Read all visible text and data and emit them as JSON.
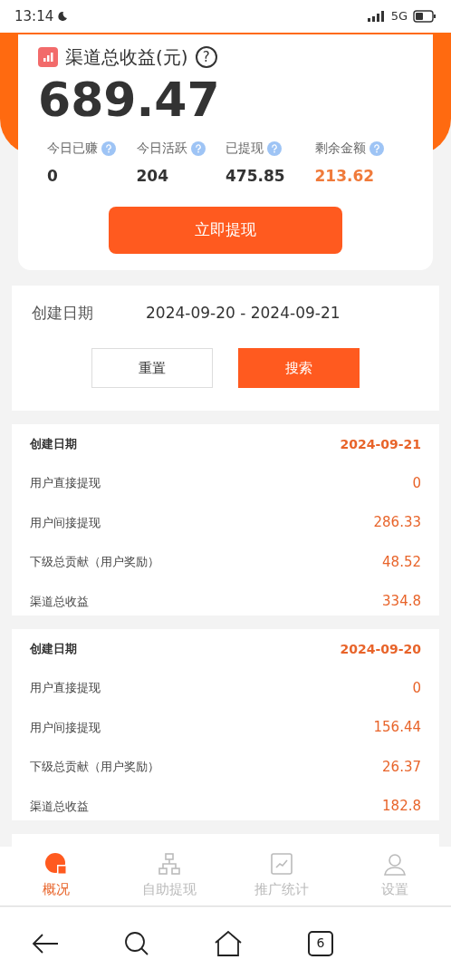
{
  "status_bar": {
    "time": "13:14",
    "network": "5G"
  },
  "summary": {
    "title": "渠道总收益(元)",
    "help": "?",
    "total": "689.47",
    "stats": [
      {
        "label": "今日已赚",
        "value": "0",
        "highlight": false
      },
      {
        "label": "今日活跃",
        "value": "204",
        "highlight": false
      },
      {
        "label": "已提现",
        "value": "475.85",
        "highlight": false
      },
      {
        "label": "剩余金额",
        "value": "213.62",
        "highlight": true
      }
    ],
    "withdraw_button": "立即提现"
  },
  "filter": {
    "label": "创建日期",
    "date_range": "2024-09-20 - 2024-09-21",
    "reset_button": "重置",
    "search_button": "搜索"
  },
  "records": [
    {
      "date_label": "创建日期",
      "date": "2024-09-21",
      "fields": [
        {
          "label": "用户直接提现",
          "value": "0"
        },
        {
          "label": "用户间接提现",
          "value": "286.33"
        },
        {
          "label": "下级总贡献（用户奖励）",
          "value": "48.52"
        },
        {
          "label": "渠道总收益",
          "value": "334.8"
        }
      ]
    },
    {
      "date_label": "创建日期",
      "date": "2024-09-20",
      "fields": [
        {
          "label": "用户直接提现",
          "value": "0"
        },
        {
          "label": "用户间接提现",
          "value": "156.44"
        },
        {
          "label": "下级总贡献（用户奖励）",
          "value": "26.37"
        },
        {
          "label": "渠道总收益",
          "value": "182.8"
        }
      ]
    }
  ],
  "tab_bar": [
    {
      "label": "概况",
      "kind": "pie",
      "selected": true
    },
    {
      "label": "自助提现",
      "kind": "tree",
      "selected": false
    },
    {
      "label": "推广统计",
      "kind": "chart",
      "selected": false
    },
    {
      "label": "设置",
      "kind": "user",
      "selected": false
    }
  ],
  "browser_bar": {
    "tab_count": "6"
  }
}
